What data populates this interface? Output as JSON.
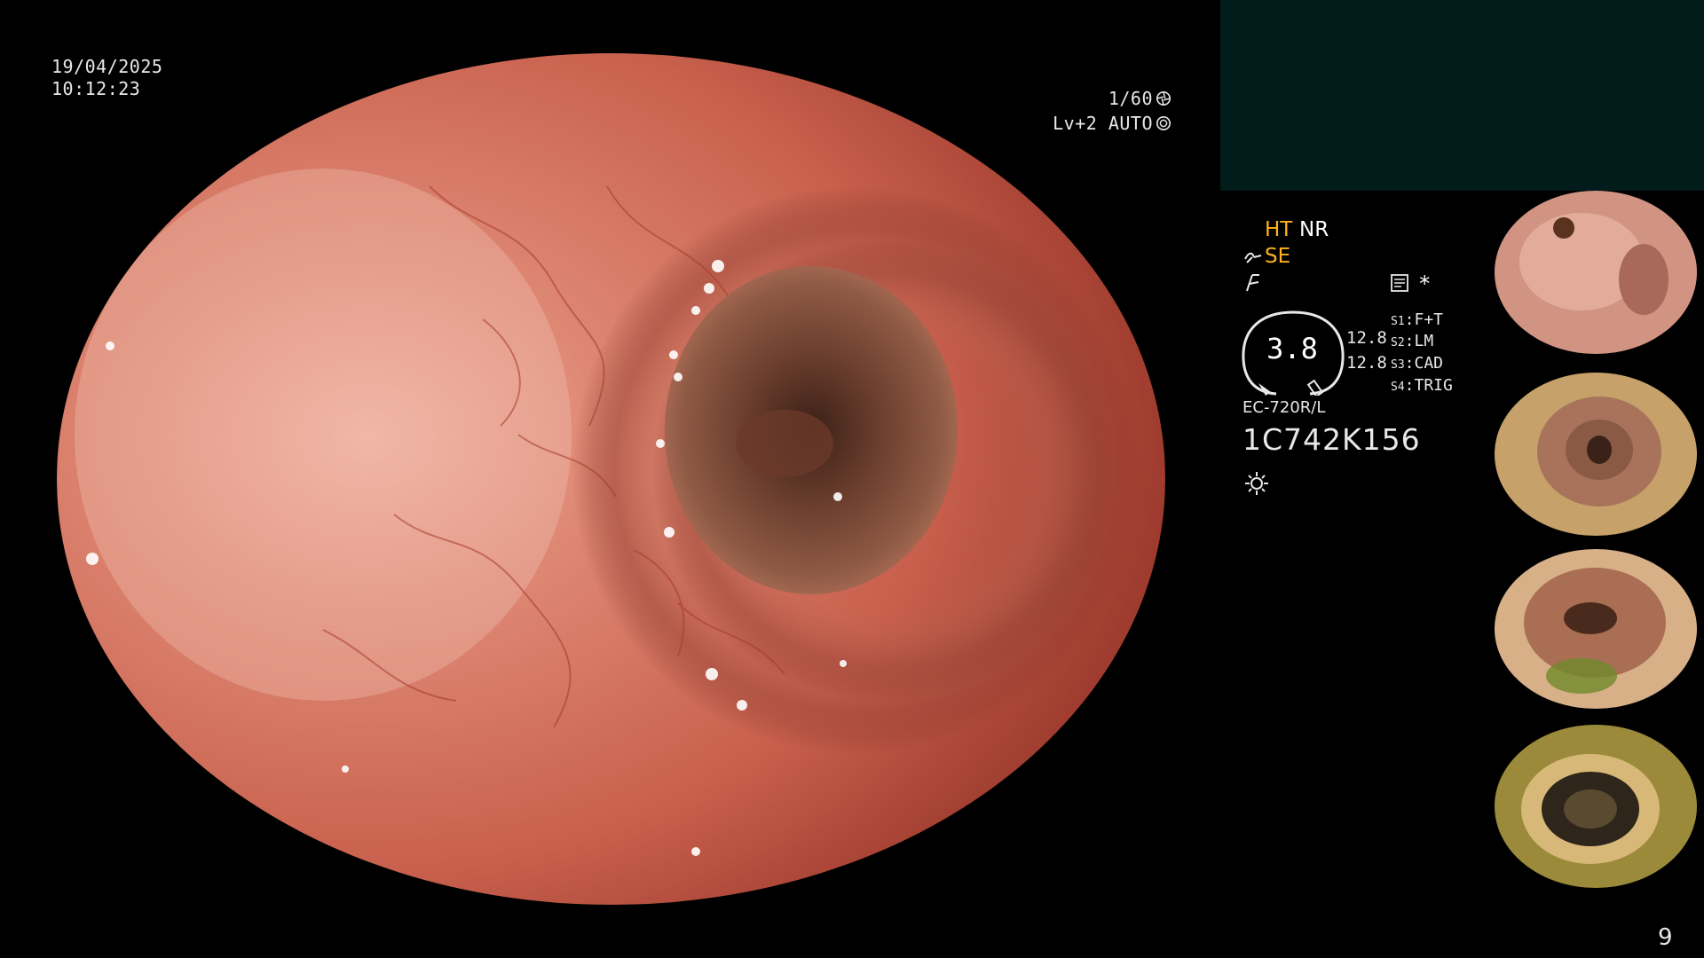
{
  "osd": {
    "date": "19/04/2025",
    "time": "10:12:23",
    "shutter": "1/60",
    "level": "Lv+2 AUTO"
  },
  "modes": {
    "ht": "HT",
    "nr": "NR",
    "se": "SE",
    "asterisk": "*"
  },
  "gauge": {
    "value": "3.8",
    "scale_1": "12.8",
    "scale_2": "12.8"
  },
  "switches": [
    {
      "key": "S1",
      "value": "F+T"
    },
    {
      "key": "S2",
      "value": "LM"
    },
    {
      "key": "S3",
      "value": "CAD"
    },
    {
      "key": "S4",
      "value": "TRIG"
    }
  ],
  "scope": {
    "model": "EC-720R/L",
    "serial": "1C742K156"
  },
  "page_number": "9",
  "icons": {
    "shutter": "aperture-icon",
    "level": "iris-icon",
    "se": "curve-arrow-icon",
    "filter": "filter-icon",
    "memo": "memo-icon",
    "light": "light-icon"
  },
  "colors": {
    "accent": "#ffb21a",
    "panel": "#021c1c",
    "text": "#e8e8e8"
  }
}
